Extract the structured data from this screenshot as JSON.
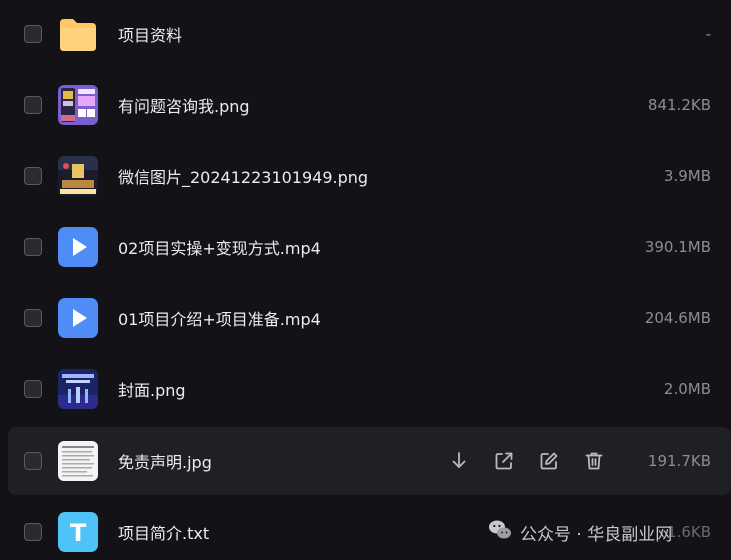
{
  "files": [
    {
      "type": "folder",
      "thumb": "folder-icon",
      "name": "项目资料",
      "size": "-"
    },
    {
      "type": "image",
      "thumb": "image-thumbnail-purple",
      "name": "有问题咨询我.png",
      "size": "841.2KB"
    },
    {
      "type": "image",
      "thumb": "image-thumbnail-dark-cover",
      "name": "微信图片_20241223101949.png",
      "size": "3.9MB"
    },
    {
      "type": "video",
      "thumb": "video-play-icon",
      "name": "02项目实操+变现方式.mp4",
      "size": "390.1MB"
    },
    {
      "type": "video",
      "thumb": "video-play-icon",
      "name": "01项目介绍+项目准备.mp4",
      "size": "204.6MB"
    },
    {
      "type": "image",
      "thumb": "image-thumbnail-blue-cover",
      "name": "封面.png",
      "size": "2.0MB"
    },
    {
      "type": "image",
      "thumb": "image-thumbnail-document",
      "name": "免责声明.jpg",
      "size": "191.7KB",
      "hovered": true
    },
    {
      "type": "text",
      "thumb": "text-file-icon",
      "name": "项目简介.txt",
      "size": "1.6KB"
    }
  ],
  "row_actions": [
    "download-icon",
    "share-icon",
    "edit-icon",
    "delete-icon"
  ],
  "watermark": {
    "text": "公众号 · 华良副业网",
    "icon": "wechat-icon"
  },
  "colors": {
    "background": "#131317",
    "hover_row": "#1f2024",
    "folder": "#ffc766",
    "video": "#4f8cf6",
    "text_file": "#4fc3f7"
  }
}
